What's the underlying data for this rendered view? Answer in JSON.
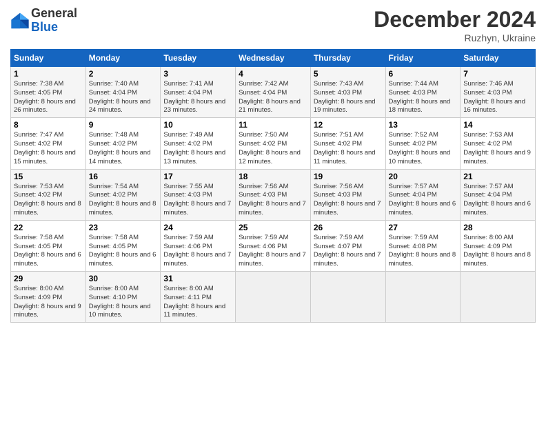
{
  "header": {
    "logo_line1": "General",
    "logo_line2": "Blue",
    "month_title": "December 2024",
    "location": "Ruzhyn, Ukraine"
  },
  "weekdays": [
    "Sunday",
    "Monday",
    "Tuesday",
    "Wednesday",
    "Thursday",
    "Friday",
    "Saturday"
  ],
  "weeks": [
    [
      {
        "day": "1",
        "sunrise": "7:38 AM",
        "sunset": "4:05 PM",
        "daylight": "8 hours and 26 minutes."
      },
      {
        "day": "2",
        "sunrise": "7:40 AM",
        "sunset": "4:04 PM",
        "daylight": "8 hours and 24 minutes."
      },
      {
        "day": "3",
        "sunrise": "7:41 AM",
        "sunset": "4:04 PM",
        "daylight": "8 hours and 23 minutes."
      },
      {
        "day": "4",
        "sunrise": "7:42 AM",
        "sunset": "4:04 PM",
        "daylight": "8 hours and 21 minutes."
      },
      {
        "day": "5",
        "sunrise": "7:43 AM",
        "sunset": "4:03 PM",
        "daylight": "8 hours and 19 minutes."
      },
      {
        "day": "6",
        "sunrise": "7:44 AM",
        "sunset": "4:03 PM",
        "daylight": "8 hours and 18 minutes."
      },
      {
        "day": "7",
        "sunrise": "7:46 AM",
        "sunset": "4:03 PM",
        "daylight": "8 hours and 16 minutes."
      }
    ],
    [
      {
        "day": "8",
        "sunrise": "7:47 AM",
        "sunset": "4:02 PM",
        "daylight": "8 hours and 15 minutes."
      },
      {
        "day": "9",
        "sunrise": "7:48 AM",
        "sunset": "4:02 PM",
        "daylight": "8 hours and 14 minutes."
      },
      {
        "day": "10",
        "sunrise": "7:49 AM",
        "sunset": "4:02 PM",
        "daylight": "8 hours and 13 minutes."
      },
      {
        "day": "11",
        "sunrise": "7:50 AM",
        "sunset": "4:02 PM",
        "daylight": "8 hours and 12 minutes."
      },
      {
        "day": "12",
        "sunrise": "7:51 AM",
        "sunset": "4:02 PM",
        "daylight": "8 hours and 11 minutes."
      },
      {
        "day": "13",
        "sunrise": "7:52 AM",
        "sunset": "4:02 PM",
        "daylight": "8 hours and 10 minutes."
      },
      {
        "day": "14",
        "sunrise": "7:53 AM",
        "sunset": "4:02 PM",
        "daylight": "8 hours and 9 minutes."
      }
    ],
    [
      {
        "day": "15",
        "sunrise": "7:53 AM",
        "sunset": "4:02 PM",
        "daylight": "8 hours and 8 minutes."
      },
      {
        "day": "16",
        "sunrise": "7:54 AM",
        "sunset": "4:02 PM",
        "daylight": "8 hours and 8 minutes."
      },
      {
        "day": "17",
        "sunrise": "7:55 AM",
        "sunset": "4:03 PM",
        "daylight": "8 hours and 7 minutes."
      },
      {
        "day": "18",
        "sunrise": "7:56 AM",
        "sunset": "4:03 PM",
        "daylight": "8 hours and 7 minutes."
      },
      {
        "day": "19",
        "sunrise": "7:56 AM",
        "sunset": "4:03 PM",
        "daylight": "8 hours and 7 minutes."
      },
      {
        "day": "20",
        "sunrise": "7:57 AM",
        "sunset": "4:04 PM",
        "daylight": "8 hours and 6 minutes."
      },
      {
        "day": "21",
        "sunrise": "7:57 AM",
        "sunset": "4:04 PM",
        "daylight": "8 hours and 6 minutes."
      }
    ],
    [
      {
        "day": "22",
        "sunrise": "7:58 AM",
        "sunset": "4:05 PM",
        "daylight": "8 hours and 6 minutes."
      },
      {
        "day": "23",
        "sunrise": "7:58 AM",
        "sunset": "4:05 PM",
        "daylight": "8 hours and 6 minutes."
      },
      {
        "day": "24",
        "sunrise": "7:59 AM",
        "sunset": "4:06 PM",
        "daylight": "8 hours and 7 minutes."
      },
      {
        "day": "25",
        "sunrise": "7:59 AM",
        "sunset": "4:06 PM",
        "daylight": "8 hours and 7 minutes."
      },
      {
        "day": "26",
        "sunrise": "7:59 AM",
        "sunset": "4:07 PM",
        "daylight": "8 hours and 7 minutes."
      },
      {
        "day": "27",
        "sunrise": "7:59 AM",
        "sunset": "4:08 PM",
        "daylight": "8 hours and 8 minutes."
      },
      {
        "day": "28",
        "sunrise": "8:00 AM",
        "sunset": "4:09 PM",
        "daylight": "8 hours and 8 minutes."
      }
    ],
    [
      {
        "day": "29",
        "sunrise": "8:00 AM",
        "sunset": "4:09 PM",
        "daylight": "8 hours and 9 minutes."
      },
      {
        "day": "30",
        "sunrise": "8:00 AM",
        "sunset": "4:10 PM",
        "daylight": "8 hours and 10 minutes."
      },
      {
        "day": "31",
        "sunrise": "8:00 AM",
        "sunset": "4:11 PM",
        "daylight": "8 hours and 11 minutes."
      },
      null,
      null,
      null,
      null
    ]
  ]
}
